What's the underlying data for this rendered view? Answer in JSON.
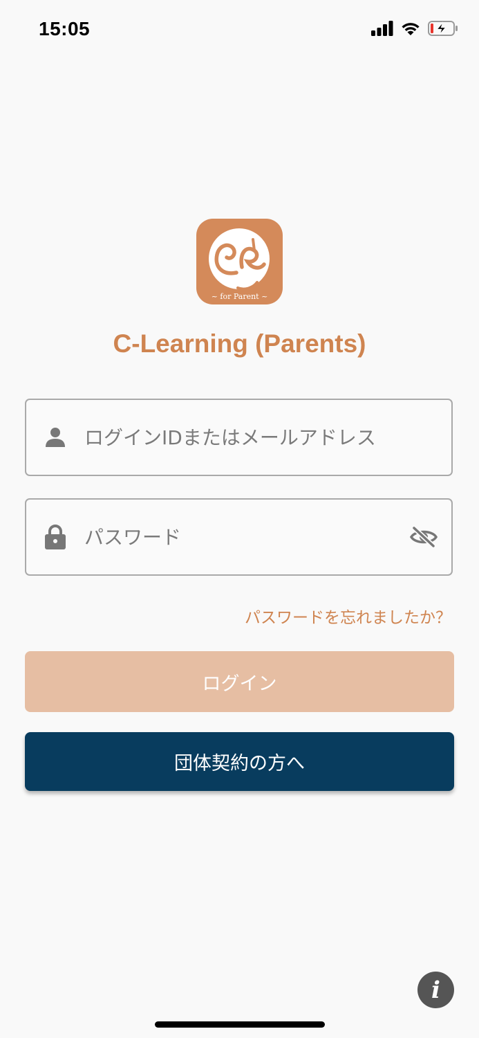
{
  "status_bar": {
    "time": "15:05",
    "icons": [
      "cellular-signal-icon",
      "wifi-icon",
      "battery-charging-icon"
    ]
  },
  "logo": {
    "caption": "~ for Parent ~"
  },
  "app": {
    "title": "C-Learning (Parents)"
  },
  "login_form": {
    "login_id": {
      "value": "",
      "placeholder": "ログインIDまたはメールアドレス",
      "icon": "person-icon"
    },
    "password": {
      "value": "",
      "placeholder": "パスワード",
      "icon": "lock-icon",
      "toggle_icon": "eye-off-icon"
    },
    "forgot_password_label": "パスワードを忘れましたか？",
    "login_button_label": "ログイン",
    "org_contract_button_label": "団体契約の方へ"
  },
  "info_button": {
    "label": "i",
    "icon": "info-icon"
  },
  "colors": {
    "accent": "#cf8450",
    "logo_bg": "#d48a5a",
    "login_button_disabled": "#e6bea3",
    "navy_button": "#083c5e",
    "background": "#f9f9f9"
  }
}
